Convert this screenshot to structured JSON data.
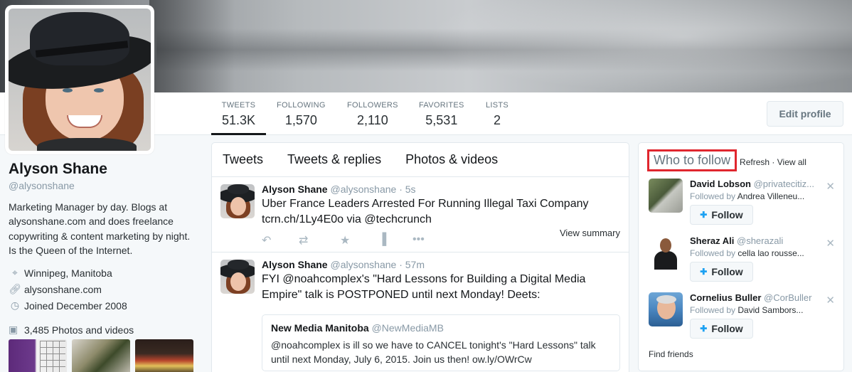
{
  "profile": {
    "name": "Alyson Shane",
    "handle": "@alysonshane",
    "bio": "Marketing Manager by day. Blogs at alysonshane.com and does freelance copywriting & content marketing by night. Is the Queen of the Internet.",
    "location": "Winnipeg, Manitoba",
    "website": "alysonshane.com",
    "joined": "Joined December 2008",
    "photos_videos": "3,485 Photos and videos"
  },
  "stats": [
    {
      "label": "TWEETS",
      "value": "51.3K"
    },
    {
      "label": "FOLLOWING",
      "value": "1,570"
    },
    {
      "label": "FOLLOWERS",
      "value": "2,110"
    },
    {
      "label": "FAVORITES",
      "value": "5,531"
    },
    {
      "label": "LISTS",
      "value": "2"
    }
  ],
  "edit_profile_label": "Edit profile",
  "timeline": {
    "tabs": [
      "Tweets",
      "Tweets & replies",
      "Photos & videos"
    ],
    "tweets": [
      {
        "name": "Alyson Shane",
        "handle": "@alysonshane",
        "time": "· 5s",
        "text": "Uber France Leaders Arrested For Running Illegal Taxi Company tcrn.ch/1Ly4E0o via @techcrunch",
        "view_summary": "View summary"
      },
      {
        "name": "Alyson Shane",
        "handle": "@alysonshane",
        "time": "· 57m",
        "text": "FYI @noahcomplex's \"Hard Lessons for Building a Digital Media Empire\" talk is POSTPONED until next Monday! Deets:",
        "quote": {
          "name": "New Media Manitoba",
          "handle": "@NewMediaMB",
          "text": "@noahcomplex is ill so we have to CANCEL tonight's \"Hard Lessons\" talk until next Monday, July 6, 2015. Join us then! ow.ly/OWrCw"
        }
      }
    ]
  },
  "who_to_follow": {
    "title": "Who to follow",
    "refresh": "Refresh",
    "view_all": "View all",
    "follow_label": "Follow",
    "followed_by_prefix": "Followed by",
    "suggestions": [
      {
        "name": "David Lobson",
        "handle": "@privatecitiz...",
        "followed_by": "Andrea Villeneu..."
      },
      {
        "name": "Sheraz Ali",
        "handle": "@sherazali",
        "followed_by": "cella lao rousse..."
      },
      {
        "name": "Cornelius Buller",
        "handle": "@CorBuller",
        "followed_by": "David Sambors..."
      }
    ],
    "find_friends": "Find friends"
  },
  "colors": {
    "accent": "#1da1f2",
    "highlight_box": "#e0262e",
    "muted": "#8899a6"
  }
}
